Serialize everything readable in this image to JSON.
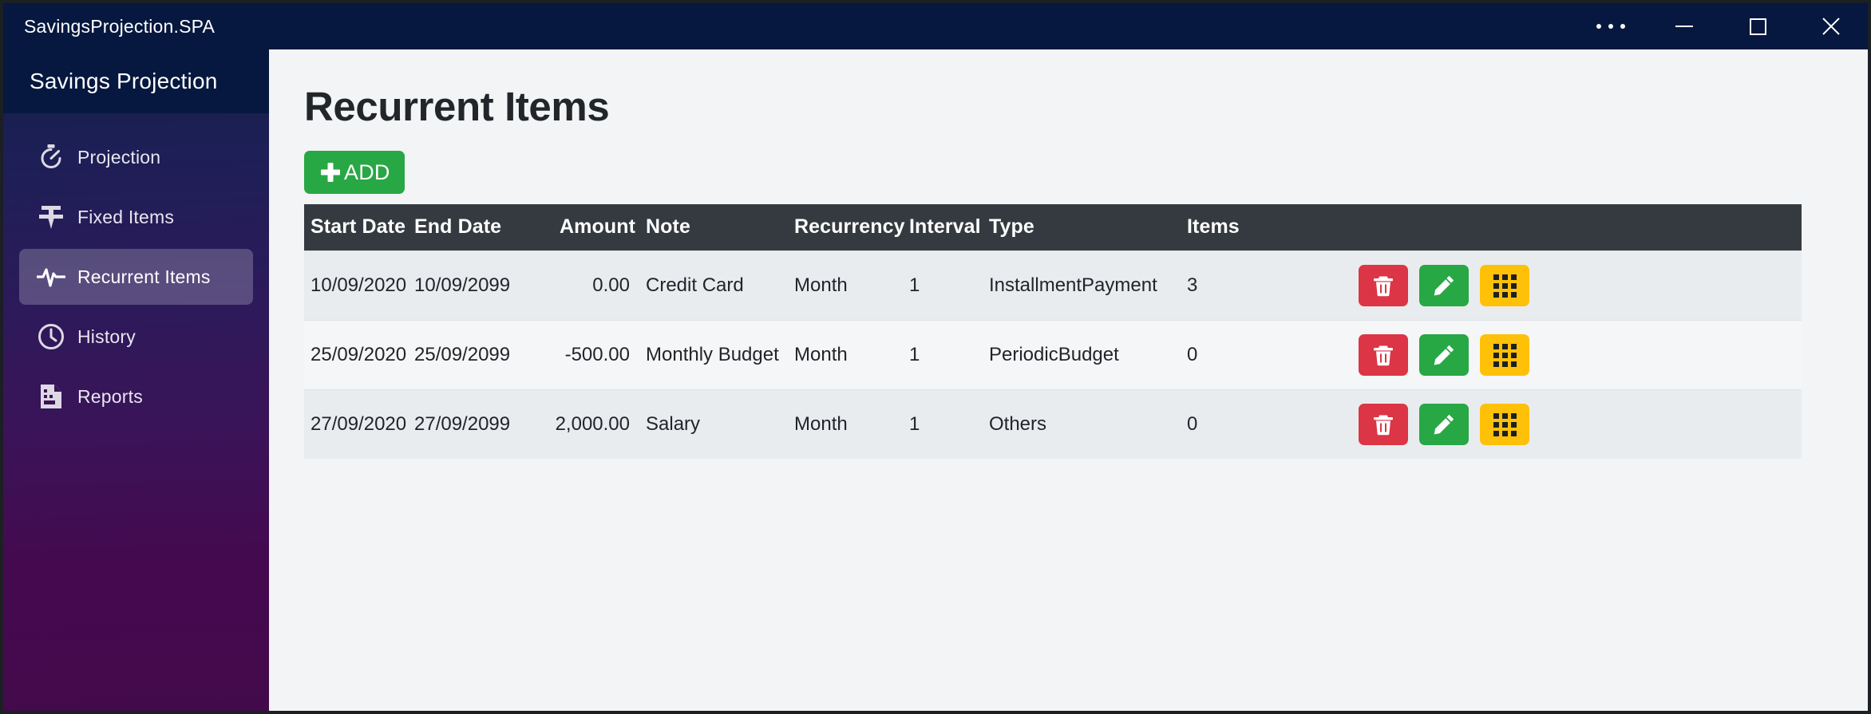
{
  "window": {
    "title": "SavingsProjection.SPA",
    "controls": [
      {
        "name": "more-options",
        "label": "…"
      },
      {
        "name": "minimize",
        "label": "–"
      },
      {
        "name": "maximize",
        "label": "□"
      },
      {
        "name": "close",
        "label": "✕"
      }
    ]
  },
  "sidebar": {
    "title": "Savings Projection",
    "items": [
      {
        "label": "Projection",
        "icon": "stopwatch-icon",
        "active": false
      },
      {
        "label": "Fixed Items",
        "icon": "pin-icon",
        "active": false
      },
      {
        "label": "Recurrent Items",
        "icon": "pulse-icon",
        "active": true
      },
      {
        "label": "History",
        "icon": "clock-icon",
        "active": false
      },
      {
        "label": "Reports",
        "icon": "report-doc-icon",
        "active": false
      }
    ]
  },
  "main": {
    "page_title": "Recurrent Items",
    "add_button": "ADD",
    "table": {
      "headers": [
        "Start Date",
        "End Date",
        "Amount",
        "Note",
        "Recurrency",
        "Interval",
        "Type",
        "Items"
      ],
      "rows": [
        {
          "start_date": "10/09/2020",
          "end_date": "10/09/2099",
          "amount": "0.00",
          "note": "Credit Card",
          "recurrency": "Month",
          "interval": "1",
          "type": "InstallmentPayment",
          "items": "3"
        },
        {
          "start_date": "25/09/2020",
          "end_date": "25/09/2099",
          "amount": "-500.00",
          "note": "Monthly Budget",
          "recurrency": "Month",
          "interval": "1",
          "type": "PeriodicBudget",
          "items": "0"
        },
        {
          "start_date": "27/09/2020",
          "end_date": "27/09/2099",
          "amount": "2,000.00",
          "note": "Salary",
          "recurrency": "Month",
          "interval": "1",
          "type": "Others",
          "items": "0"
        }
      ],
      "row_actions": [
        {
          "name": "delete-button",
          "icon": "trash-icon",
          "color": "#dc3545"
        },
        {
          "name": "edit-button",
          "icon": "pencil-icon",
          "color": "#28a745"
        },
        {
          "name": "detail-button",
          "icon": "grid-icon",
          "color": "#ffc107"
        }
      ]
    }
  },
  "colors": {
    "titlebar": "#06183f",
    "sidebar_top": "#141f47",
    "sidebar_bottom": "#430a4b",
    "accent_green": "#28a745",
    "accent_red": "#dc3545",
    "accent_yellow": "#ffc107",
    "table_header": "#343a40",
    "page_bg": "#f2f4f5"
  }
}
